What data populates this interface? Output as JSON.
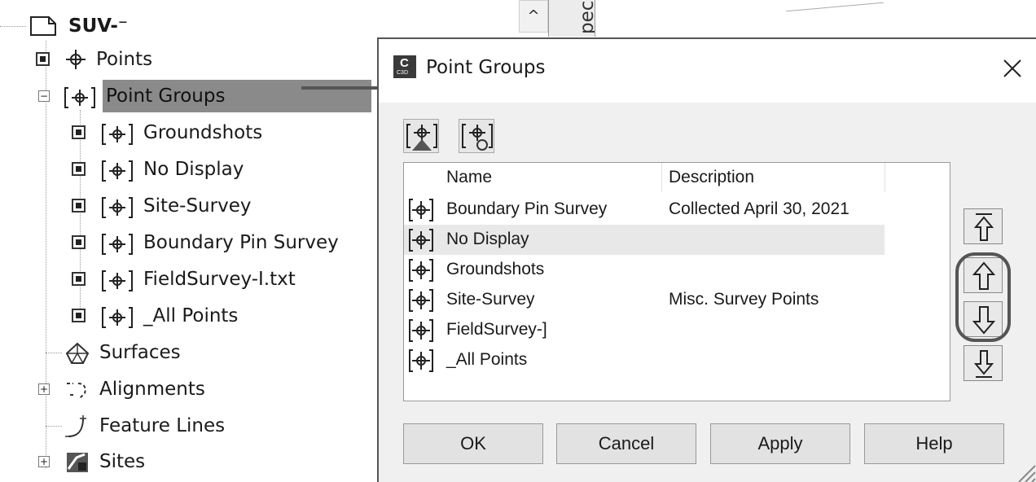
{
  "tree": {
    "root_label": "SUV-⁻",
    "items": [
      {
        "label": "Points"
      },
      {
        "label": "Point Groups"
      },
      {
        "label": "Groundshots"
      },
      {
        "label": "No Display"
      },
      {
        "label": "Site-Survey"
      },
      {
        "label": "Boundary Pin Survey"
      },
      {
        "label": "FieldSurvey-I.txt"
      },
      {
        "label": "_All Points"
      },
      {
        "label": "Surfaces"
      },
      {
        "label": "Alignments"
      },
      {
        "label": "Feature Lines"
      },
      {
        "label": "Sites"
      }
    ]
  },
  "side_tab": {
    "label": "pect"
  },
  "dialog": {
    "title": "Point Groups",
    "app_icon": {
      "letter": "C",
      "sub": "C3D"
    },
    "columns": {
      "name": "Name",
      "description": "Description"
    },
    "rows": [
      {
        "name": "Boundary Pin Survey",
        "description": "Collected April 30, 2021"
      },
      {
        "name": "No Display",
        "description": ""
      },
      {
        "name": "Groundshots",
        "description": ""
      },
      {
        "name": "Site-Survey",
        "description": "Misc. Survey Points"
      },
      {
        "name": "FieldSurvey-]",
        "description": ""
      },
      {
        "name": "_All Points",
        "description": ""
      }
    ],
    "buttons": {
      "ok": "OK",
      "cancel": "Cancel",
      "apply": "Apply",
      "help": "Help"
    }
  }
}
